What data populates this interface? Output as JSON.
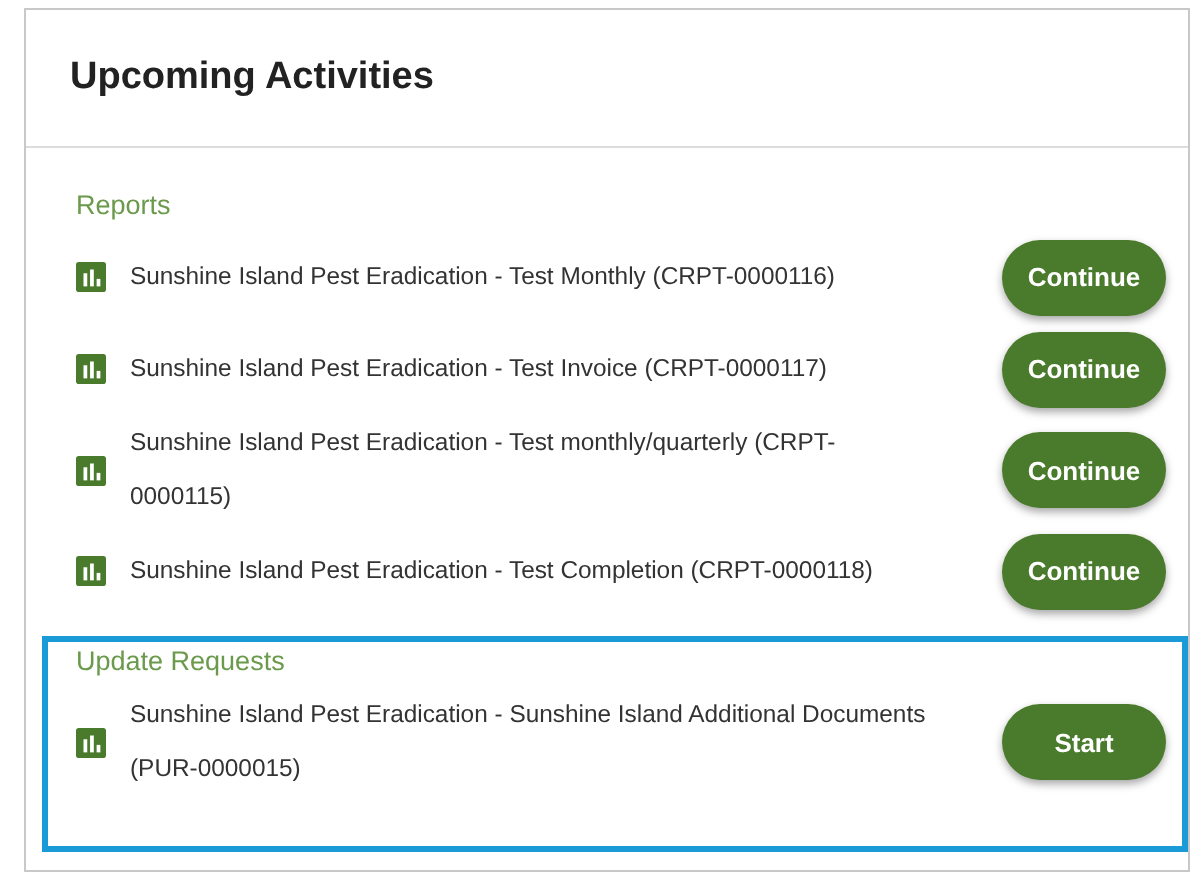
{
  "card": {
    "title": "Upcoming Activities"
  },
  "sections": [
    {
      "heading": "Reports",
      "highlighted": false,
      "items": [
        {
          "text": "Sunshine Island Pest Eradication - Test Monthly (CRPT-0000116)",
          "action": "Continue"
        },
        {
          "text": "Sunshine Island Pest Eradication - Test Invoice (CRPT-0000117)",
          "action": "Continue"
        },
        {
          "text": "Sunshine Island Pest Eradication - Test monthly/quarterly (CRPT-0000115)",
          "action": "Continue"
        },
        {
          "text": "Sunshine Island Pest Eradication - Test Completion (CRPT-0000118)",
          "action": "Continue"
        }
      ]
    },
    {
      "heading": "Update Requests",
      "highlighted": true,
      "items": [
        {
          "text": "Sunshine Island Pest Eradication - Sunshine Island Additional Documents (PUR-0000015)",
          "action": "Start"
        }
      ]
    }
  ]
}
